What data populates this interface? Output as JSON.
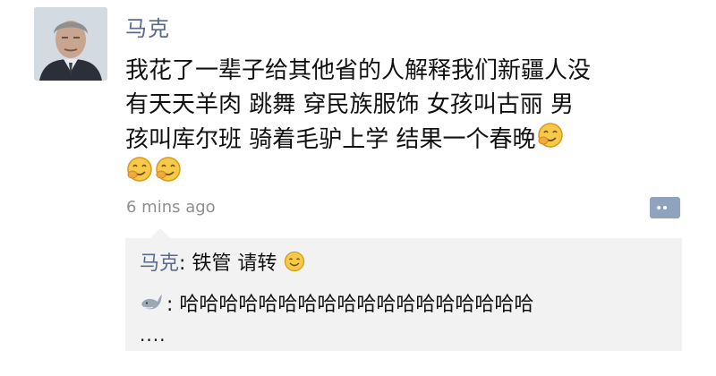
{
  "post": {
    "author": "马克",
    "lines": [
      "我花了一辈子给其他省的人解释我们新疆人没",
      "有天天羊肉 跳舞 穿民族服饰 女孩叫古丽 男",
      "孩叫库尔班 骑着毛驴上学  结果一个春晚"
    ],
    "emoji_icon": "smirk-emoji-icon",
    "time": "6 mins ago"
  },
  "comments": [
    {
      "author": "马克",
      "separator": ": ",
      "text": "铁管 请转",
      "emoji_icon": "smile-emoji-icon"
    },
    {
      "author_icon": "whale-avatar-icon",
      "separator": ": ",
      "text": "哈哈哈哈哈哈哈哈哈哈哈哈哈哈哈哈哈哈",
      "continuation": "...."
    }
  ],
  "colors": {
    "name": "#5b6a91",
    "comment_bg": "#f2f2f2",
    "time": "#8f8f8f",
    "comment_button": "#8fa3bf"
  }
}
